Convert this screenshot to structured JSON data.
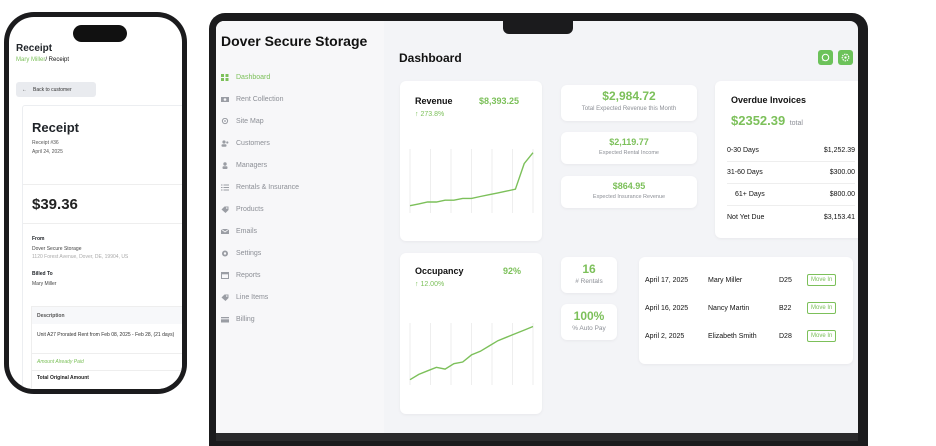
{
  "phone": {
    "title": "Receipt",
    "breadcrumb_link": "Mary Miller",
    "breadcrumb_sep": "/",
    "breadcrumb_current": " Receipt",
    "back_button": "Back to customer",
    "receipt": {
      "heading": "Receipt",
      "number": "Receipt #36",
      "date": "April 24, 2025",
      "amount": "$39.36",
      "from_label": "From",
      "from_name": "Dover Secure Storage",
      "from_address": "1120 Forest Avenue, Dover, DE, 19904, US",
      "billed_label": "Billed To",
      "billed_name": "Mary Miller",
      "table_header": "Description",
      "line_item": "Unit A27 Prorated Rent from Feb 08, 2025 - Feb 28, (21 days)",
      "paid_row": "Amount Already Paid",
      "total_row": "Total Original Amount"
    }
  },
  "app": {
    "brand": "Dover Secure Storage",
    "page_title": "Dashboard",
    "nav": [
      {
        "label": "Dashboard",
        "icon": "dashboard-icon",
        "active": true
      },
      {
        "label": "Rent Collection",
        "icon": "cash-icon"
      },
      {
        "label": "Site Map",
        "icon": "location-pin-icon"
      },
      {
        "label": "Customers",
        "icon": "customers-icon"
      },
      {
        "label": "Managers",
        "icon": "manager-icon"
      },
      {
        "label": "Rentals & Insurance",
        "icon": "list-icon"
      },
      {
        "label": "Products",
        "icon": "tag-icon"
      },
      {
        "label": "Emails",
        "icon": "email-icon"
      },
      {
        "label": "Settings",
        "icon": "gear-icon"
      },
      {
        "label": "Reports",
        "icon": "calendar-icon"
      },
      {
        "label": "Line Items",
        "icon": "tag-icon"
      },
      {
        "label": "Billing",
        "icon": "card-icon"
      }
    ],
    "header_icons": [
      "whatsapp-icon",
      "gear-icon"
    ],
    "accent_color": "#7cc05a"
  },
  "revenue": {
    "title": "Revenue",
    "value": "$8,393.25",
    "change": "↑ 273.8%",
    "trend": [
      4,
      5,
      6,
      6,
      7,
      7,
      8,
      8,
      9,
      10,
      11,
      12,
      13,
      27,
      33
    ]
  },
  "occupancy": {
    "title": "Occupancy",
    "value": "92%",
    "change": "↑ 12.00%",
    "trend": [
      3,
      6,
      8,
      10,
      9,
      12,
      13,
      17,
      19,
      22,
      25,
      27,
      29,
      31,
      33
    ]
  },
  "expected": {
    "total": {
      "value": "$2,984.72",
      "label": "Total Expected Revenue this Month"
    },
    "rental": {
      "value": "$2,119.77",
      "label": "Expected Rental Income"
    },
    "insurance": {
      "value": "$864.95",
      "label": "Expected Insurance Revenue"
    }
  },
  "overdue": {
    "title": "Overdue Invoices",
    "total": "$2352.39",
    "total_suffix": "total",
    "rows": [
      {
        "label": "0-30 Days",
        "amount": "$1,252.39"
      },
      {
        "label": "31-60 Days",
        "amount": "$300.00"
      },
      {
        "label": "61+ Days",
        "amount": "$800.00"
      },
      {
        "label": "Not Yet Due",
        "amount": "$3,153.41"
      }
    ]
  },
  "stats": {
    "rentals": {
      "value": "16",
      "label": "# Rentals"
    },
    "autopay": {
      "value": "100%",
      "label": "% Auto Pay"
    }
  },
  "move_ins": [
    {
      "date": "April 17, 2025",
      "name": "Mary Miller",
      "unit": "D25",
      "action": "Move In"
    },
    {
      "date": "April 16, 2025",
      "name": "Nancy Martin",
      "unit": "B22",
      "action": "Move In"
    },
    {
      "date": "April 2, 2025",
      "name": "Elizabeth Smith",
      "unit": "D28",
      "action": "Move In"
    }
  ]
}
